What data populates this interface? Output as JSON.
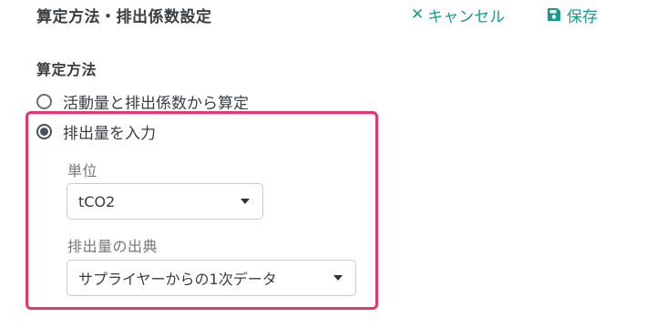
{
  "header": {
    "title": "算定方法・排出係数設定",
    "cancel_label": "キャンセル",
    "save_label": "保存"
  },
  "section": {
    "label": "算定方法"
  },
  "radio_options": [
    {
      "label": "活動量と排出係数から算定",
      "checked": false
    },
    {
      "label": "排出量を入力",
      "checked": true
    }
  ],
  "unit_field": {
    "label": "単位",
    "value": "tCO2"
  },
  "source_field": {
    "label": "排出量の出典",
    "value": "サプライヤーからの1次データ"
  },
  "colors": {
    "accent": "#1a9a8f",
    "highlight": "#e6356b"
  },
  "icons": {
    "cancel": "close-icon",
    "save": "save-icon",
    "dropdown": "chevron-down-icon"
  }
}
